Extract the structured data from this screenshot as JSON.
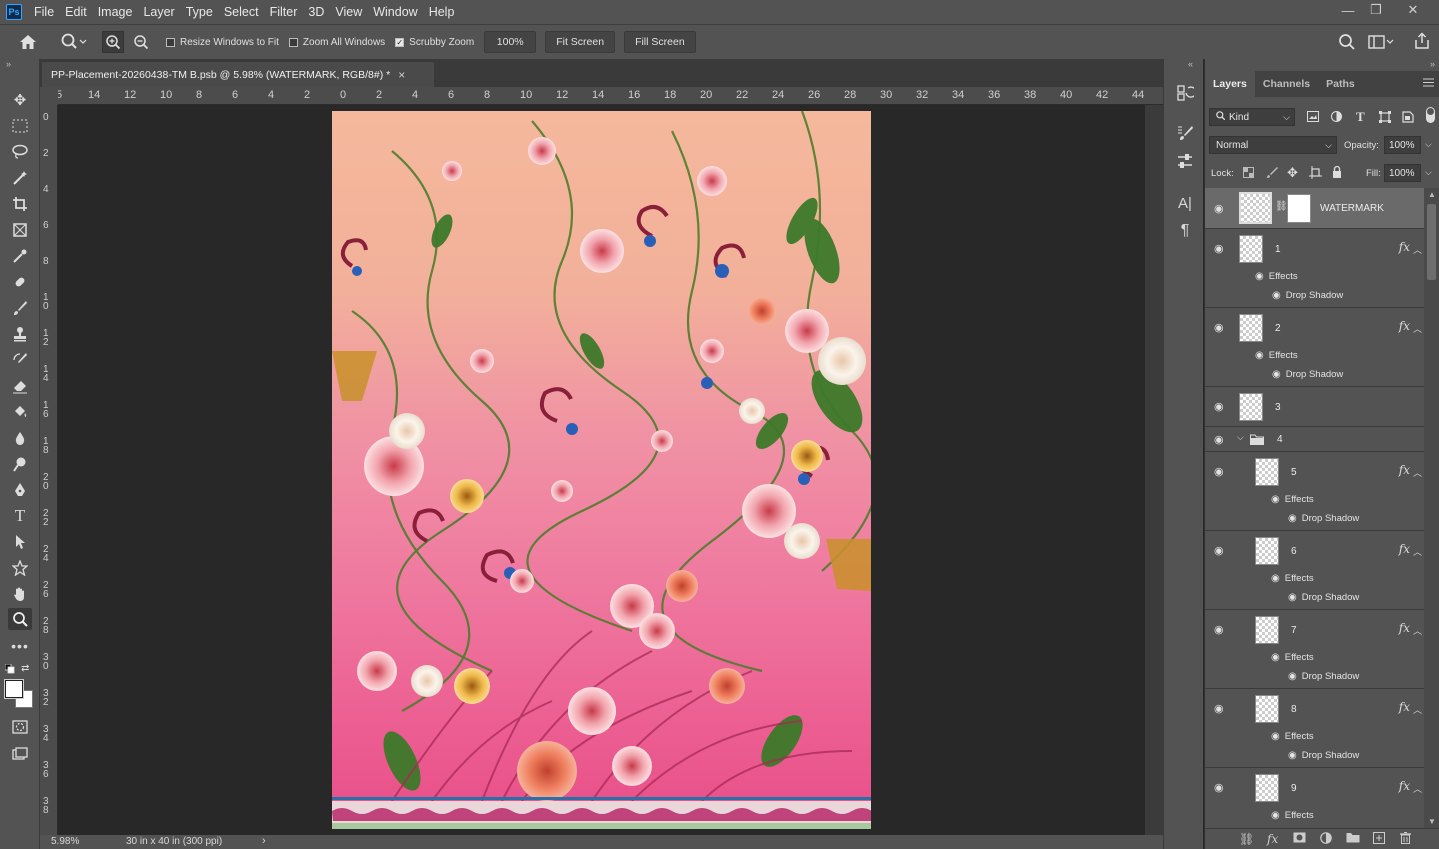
{
  "app": {
    "logo": "Ps",
    "menu": [
      "File",
      "Edit",
      "Image",
      "Layer",
      "Type",
      "Select",
      "Filter",
      "3D",
      "View",
      "Window",
      "Help"
    ],
    "window_controls": {
      "minimize": "—",
      "restore": "❐",
      "close": "✕"
    }
  },
  "options_bar": {
    "resize_windows_label": "Resize Windows to Fit",
    "resize_windows_checked": false,
    "zoom_all_label": "Zoom All Windows",
    "zoom_all_checked": false,
    "scrubby_label": "Scrubby Zoom",
    "scrubby_checked": true,
    "zoom_value": "100%",
    "fit_screen_label": "Fit Screen",
    "fill_screen_label": "Fill Screen"
  },
  "document": {
    "tab_title": "PP-Placement-20260438-TM B.psb @ 5.98% (WATERMARK, RGB/8#) *",
    "tab_close": "×",
    "ruler_h": [
      "5",
      "14",
      "12",
      "10",
      "8",
      "6",
      "4",
      "2",
      "0",
      "2",
      "4",
      "6",
      "8",
      "10",
      "12",
      "14",
      "16",
      "18",
      "20",
      "22",
      "24",
      "26",
      "28",
      "30",
      "32",
      "34",
      "36",
      "38",
      "40",
      "42",
      "44"
    ],
    "ruler_v": [
      "0",
      "2",
      "4",
      "6",
      "8",
      "10",
      "12",
      "14",
      "16",
      "18",
      "20",
      "22",
      "24",
      "26",
      "28",
      "30",
      "32",
      "34",
      "36",
      "38"
    ]
  },
  "status": {
    "zoom": "5.98%",
    "doc_size": "30 in x 40 in (300 ppi)",
    "arrow": "›"
  },
  "layers_panel": {
    "tabs": [
      "Layers",
      "Channels",
      "Paths"
    ],
    "active_tab": "Layers",
    "filter_kind": "Kind",
    "blend_mode": "Normal",
    "opacity_label": "Opacity:",
    "opacity_value": "100%",
    "lock_label": "Lock:",
    "fill_label": "Fill:",
    "fill_value": "100%",
    "effects_label": "Effects",
    "drop_shadow_label": "Drop Shadow",
    "fx_label": "fx",
    "layers": [
      {
        "name": "WATERMARK",
        "selected": true
      },
      {
        "name": "1"
      },
      {
        "name": "2"
      },
      {
        "name": "3"
      },
      {
        "name": "4",
        "group": true
      },
      {
        "name": "5"
      },
      {
        "name": "6"
      },
      {
        "name": "7"
      },
      {
        "name": "8"
      },
      {
        "name": "9"
      }
    ]
  },
  "colors": {
    "ui_bg": "#535353",
    "canvas_bg": "#282828",
    "accent": "#31a8ff",
    "art_top": "#f5b89c",
    "art_bottom": "#e84e88"
  }
}
